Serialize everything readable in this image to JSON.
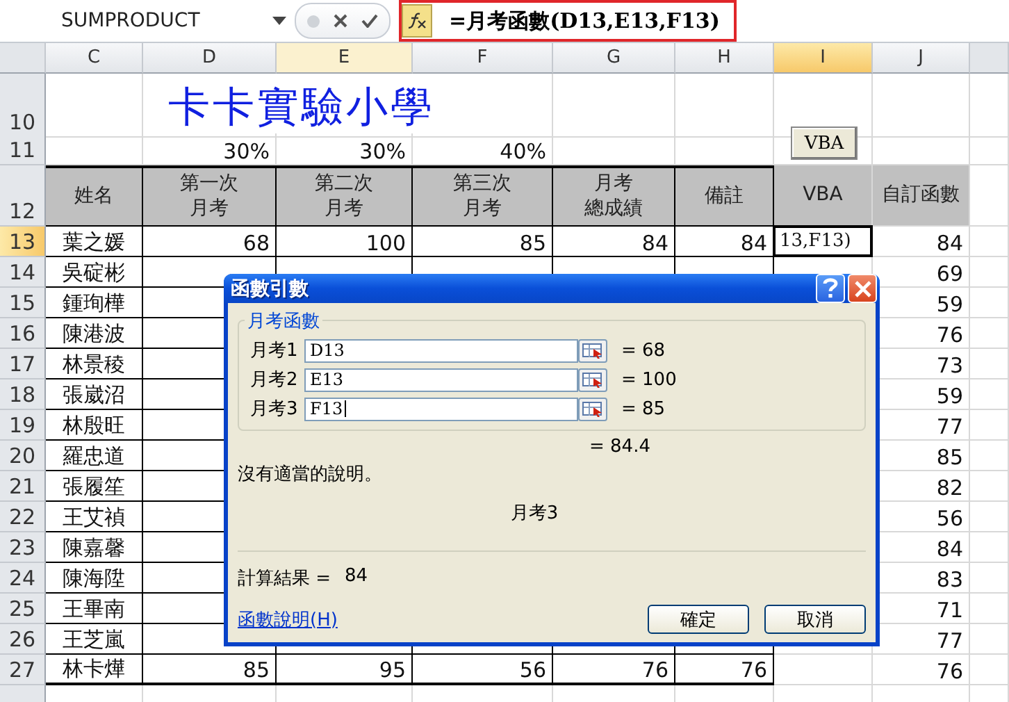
{
  "formula_bar": {
    "name_box": "SUMPRODUCT",
    "formula": "=月考函數(D13,E13,F13)"
  },
  "columns": [
    {
      "label": "C",
      "selected": false,
      "referenced": false
    },
    {
      "label": "D",
      "selected": false,
      "referenced": false
    },
    {
      "label": "E",
      "selected": false,
      "referenced": true
    },
    {
      "label": "F",
      "selected": false,
      "referenced": false
    },
    {
      "label": "G",
      "selected": false,
      "referenced": false
    },
    {
      "label": "H",
      "selected": false,
      "referenced": false
    },
    {
      "label": "I",
      "selected": true,
      "referenced": false
    },
    {
      "label": "J",
      "selected": false,
      "referenced": false
    }
  ],
  "title_row": {
    "number": "10",
    "selected": false,
    "title": "卡卡實驗小學"
  },
  "weights_row": {
    "number": "11",
    "selected": false,
    "exam1": "30%",
    "exam2": "30%",
    "exam3": "40%",
    "button": "VBA"
  },
  "header_row": {
    "number": "12",
    "selected": false,
    "name": [
      "姓名"
    ],
    "exam1": [
      "第一次",
      "月考"
    ],
    "exam2": [
      "第二次",
      "月考"
    ],
    "exam3": [
      "第三次",
      "月考"
    ],
    "total": [
      "月考",
      "總成績"
    ],
    "note": [
      "備註"
    ],
    "vba": [
      "VBA"
    ],
    "custom": [
      "自訂函數"
    ]
  },
  "rows": [
    {
      "number": "13",
      "selected": true,
      "name": "葉之媛",
      "exam1": "68",
      "exam2": "100",
      "exam3": "85",
      "total": "84",
      "note": "84",
      "vba": "13,F13)",
      "custom": "84"
    },
    {
      "number": "14",
      "selected": false,
      "name": "吳碇彬",
      "custom": "69"
    },
    {
      "number": "15",
      "selected": false,
      "name": "鍾珣樺",
      "custom": "59"
    },
    {
      "number": "16",
      "selected": false,
      "name": "陳港波",
      "custom": "76"
    },
    {
      "number": "17",
      "selected": false,
      "name": "林景稜",
      "custom": "73"
    },
    {
      "number": "18",
      "selected": false,
      "name": "張崴沼",
      "custom": "59"
    },
    {
      "number": "19",
      "selected": false,
      "name": "林殷旺",
      "custom": "77"
    },
    {
      "number": "20",
      "selected": false,
      "name": "羅忠道",
      "custom": "85"
    },
    {
      "number": "21",
      "selected": false,
      "name": "張履笙",
      "custom": "82"
    },
    {
      "number": "22",
      "selected": false,
      "name": "王艾禎",
      "custom": "56"
    },
    {
      "number": "23",
      "selected": false,
      "name": "陳嘉馨",
      "custom": "84"
    },
    {
      "number": "24",
      "selected": false,
      "name": "陳海陞",
      "custom": "83"
    },
    {
      "number": "25",
      "selected": false,
      "name": "王畢南",
      "custom": "71"
    },
    {
      "number": "26",
      "selected": false,
      "name": "王芝嵐",
      "custom": "77"
    },
    {
      "number": "27",
      "selected": false,
      "name": "林卡燁",
      "exam1": "85",
      "exam2": "95",
      "exam3": "56",
      "total": "76",
      "note": "76",
      "custom": "76"
    }
  ],
  "dialog": {
    "title": "函數引數",
    "group": "月考函數",
    "arguments": [
      {
        "label": "月考1",
        "value": "D13",
        "result": "= 68"
      },
      {
        "label": "月考2",
        "value": "E13",
        "result": "= 100"
      },
      {
        "label": "月考3",
        "value": "F13",
        "result": "= 85"
      }
    ],
    "result": "= 84.4",
    "description": "沒有適當的說明。",
    "argument_help": "月考3",
    "calc_label": "計算結果 =",
    "calc_value": "84",
    "help_link": "函數說明(H)",
    "buttons": [
      "確定",
      "取消"
    ]
  }
}
